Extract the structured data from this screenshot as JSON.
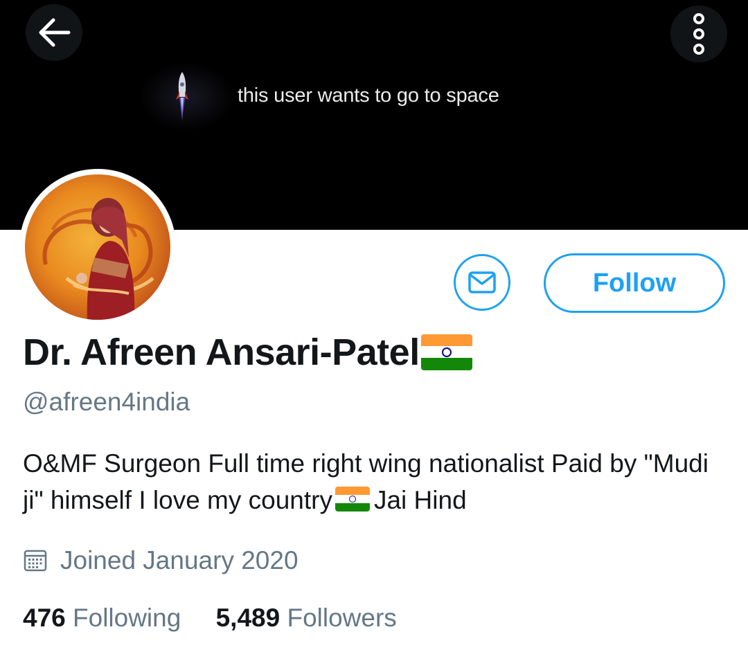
{
  "header": {
    "back_icon": "arrow-left-icon",
    "more_icon": "more-vertical-icon",
    "banner_text": "this user wants to go to space",
    "banner_icon": "rocket-icon"
  },
  "profile": {
    "name": "Dr. Afreen Ansari-Patel",
    "name_emoji": "flag-india",
    "handle": "@afreen4india",
    "bio_part1": "O&MF Surgeon Full time right wing nationalist Paid by \"Mudi ji\" himself I love my country",
    "bio_emoji": "flag-india",
    "bio_part2": "Jai Hind",
    "joined": "Joined January 2020",
    "joined_icon": "calendar-icon"
  },
  "actions": {
    "message_icon": "envelope-icon",
    "follow_label": "Follow"
  },
  "stats": {
    "following_count": "476",
    "following_label": "Following",
    "followers_count": "5,489",
    "followers_label": "Followers"
  },
  "colors": {
    "accent": "#1da1f2",
    "secondary_text": "#657786",
    "primary_text": "#14171a",
    "banner_bg": "#000000"
  }
}
